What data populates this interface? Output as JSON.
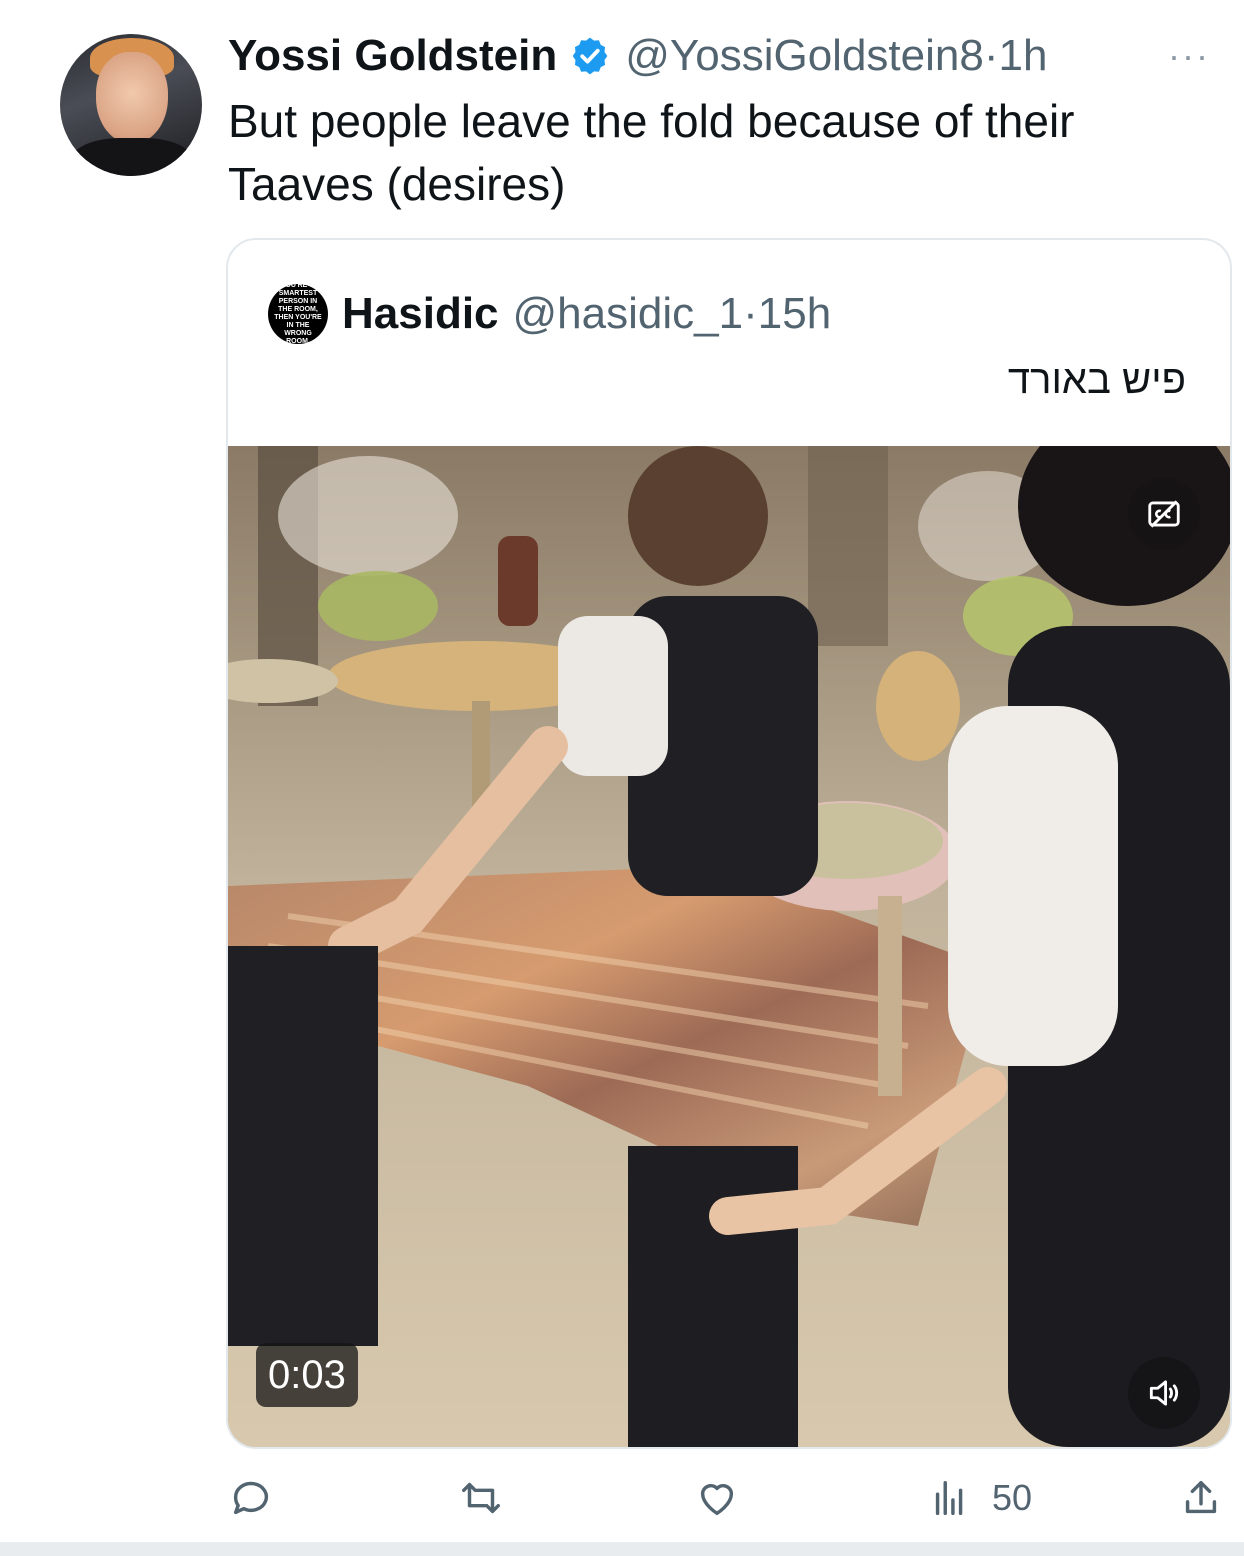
{
  "tweet": {
    "author_name": "Yossi Goldstein",
    "author_handle": "@YossiGoldstein8",
    "separator": "·",
    "time": "1h",
    "more_label": "···",
    "text": "But people leave the fold because of their Taaves (desires)"
  },
  "quoted": {
    "avatar_text": "IF YOU'RE THE SMARTEST PERSON IN THE ROOM, THEN YOU'RE IN THE WRONG ROOM.",
    "author_name": "Hasidic",
    "author_handle": "@hasidic_1",
    "separator": "·",
    "time": "15h",
    "text": "פיש באורד",
    "video": {
      "timestamp": "0:03"
    }
  },
  "actions": {
    "views_count": "50"
  },
  "colors": {
    "verified_blue": "#1d9bf0",
    "secondary_text": "#536471",
    "border": "#e3e8ec"
  }
}
